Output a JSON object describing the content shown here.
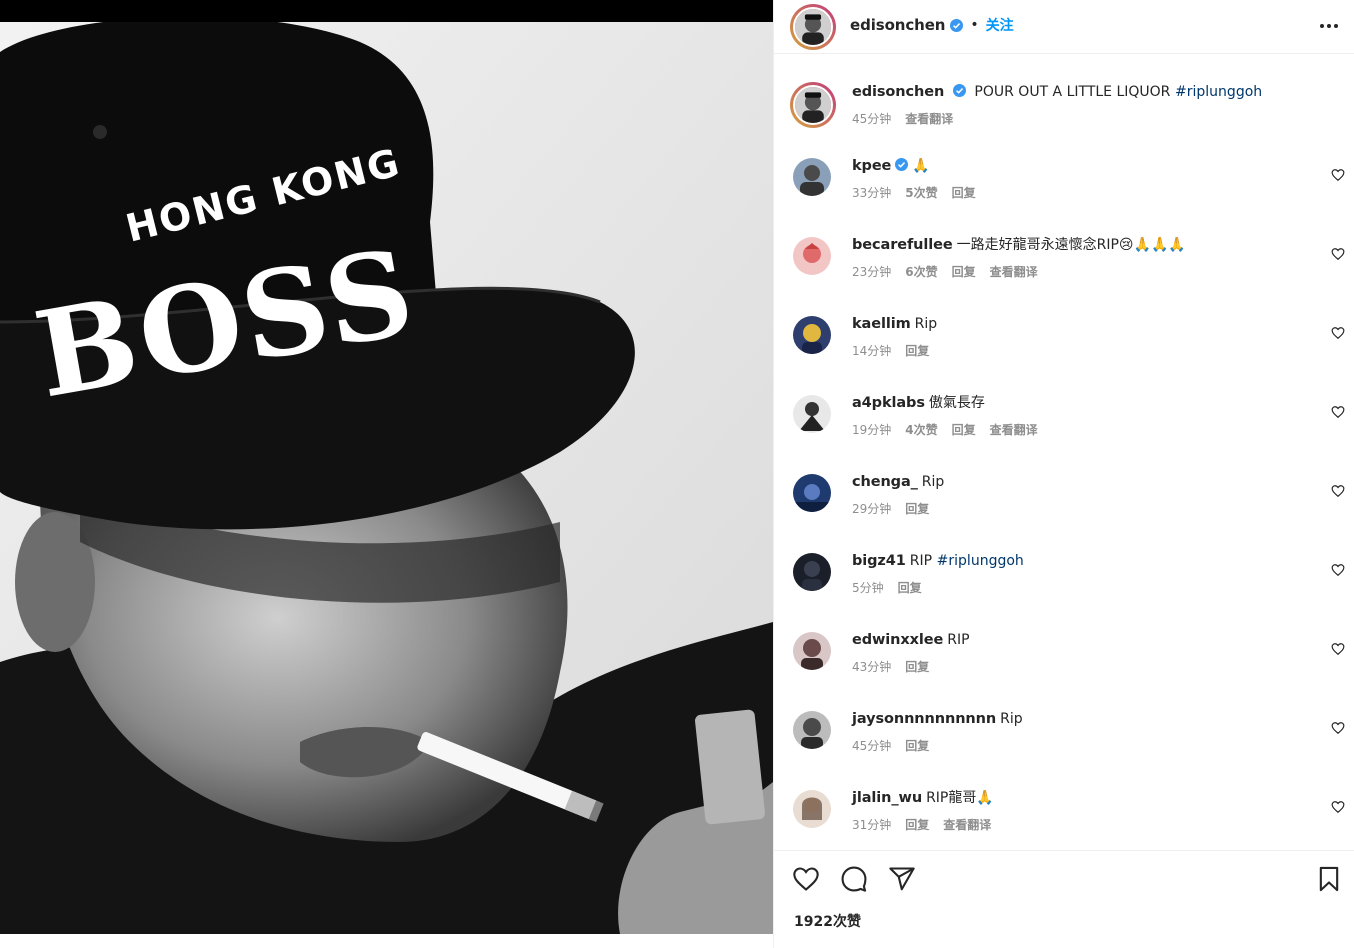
{
  "post": {
    "author": "edisonchen",
    "follow_label": "关注",
    "separator": "•",
    "caption_text": "POUR OUT A LITTLE LIQUOR",
    "caption_hashtag": "#riplunggoh",
    "caption_time": "45分钟",
    "caption_translate": "查看翻译",
    "likes": "1922次赞"
  },
  "photo": {
    "cap_line1": "HONG KONG",
    "cap_line2": "BOSS"
  },
  "comments": [
    {
      "user": "kpee",
      "verified": true,
      "text": "🙏",
      "time": "33分钟",
      "likes": "5次赞",
      "reply": "回复",
      "translate": ""
    },
    {
      "user": "becarefullee",
      "verified": false,
      "text": "一路走好龍哥永遠懷念RIP😢🙏🙏🙏",
      "time": "23分钟",
      "likes": "6次赞",
      "reply": "回复",
      "translate": "查看翻译"
    },
    {
      "user": "kaellim",
      "verified": false,
      "text": "Rip",
      "time": "14分钟",
      "likes": "",
      "reply": "回复",
      "translate": ""
    },
    {
      "user": "a4pklabs",
      "verified": false,
      "text": "傲氣長存",
      "time": "19分钟",
      "likes": "4次赞",
      "reply": "回复",
      "translate": "查看翻译"
    },
    {
      "user": "chenga_",
      "verified": false,
      "text": "Rip",
      "time": "29分钟",
      "likes": "",
      "reply": "回复",
      "translate": ""
    },
    {
      "user": "bigz41",
      "verified": false,
      "text": "RIP",
      "hashtag": "#riplunggoh",
      "time": "5分钟",
      "likes": "",
      "reply": "回复",
      "translate": ""
    },
    {
      "user": "edwinxxlee",
      "verified": false,
      "text": "RIP",
      "time": "43分钟",
      "likes": "",
      "reply": "回复",
      "translate": ""
    },
    {
      "user": "jaysonnnnnnnnnn",
      "verified": false,
      "text": "Rip",
      "time": "45分钟",
      "likes": "",
      "reply": "回复",
      "translate": ""
    },
    {
      "user": "jlalin_wu",
      "verified": false,
      "text": "RIP龍哥🙏",
      "time": "31分钟",
      "likes": "",
      "reply": "回复",
      "translate": "查看翻译"
    }
  ],
  "icons": {
    "header_more": "more-horizontal-icon",
    "verified": "verified-badge-icon",
    "comment_like": "heart-outline-icon",
    "like": "heart-outline-icon",
    "comment": "comment-bubble-icon",
    "share": "paper-plane-icon",
    "save": "bookmark-icon"
  },
  "colors": {
    "verified_blue": "#3897f0",
    "link_blue": "#0095f6",
    "hashtag": "#00376b",
    "meta_gray": "#8e8e8e"
  }
}
